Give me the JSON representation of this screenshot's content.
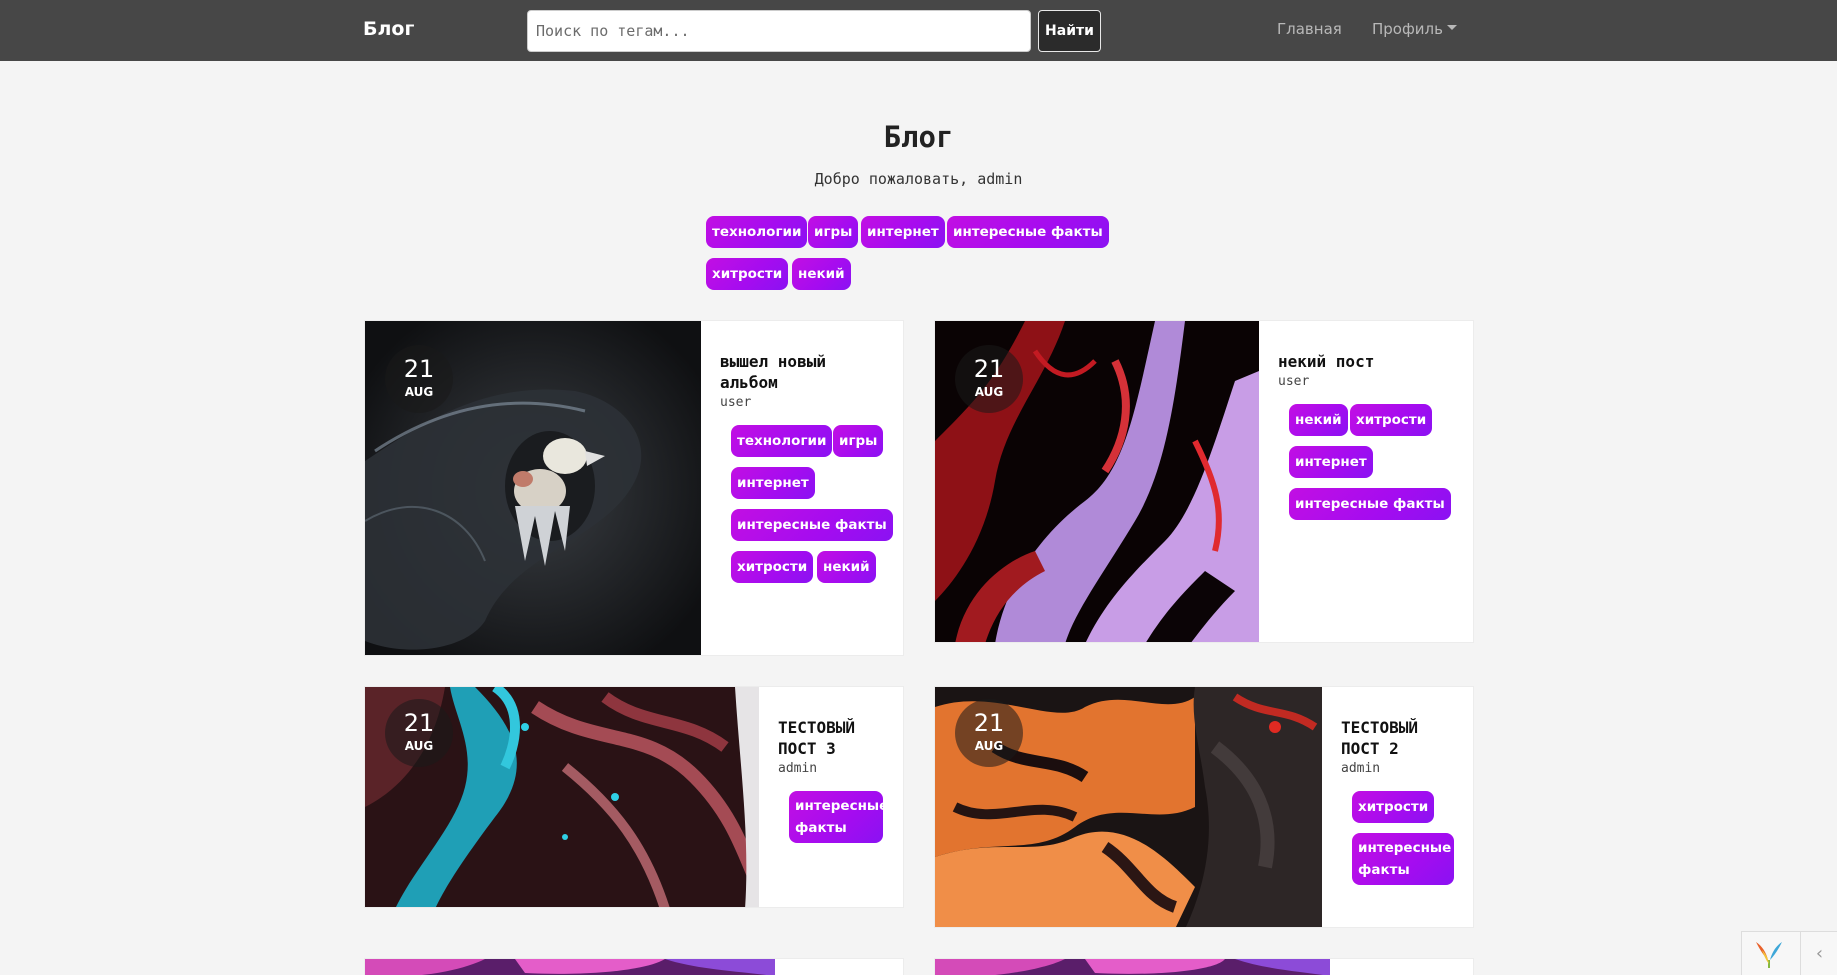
{
  "navbar": {
    "brand": "Блог",
    "search_placeholder": "Поиск по тегам...",
    "search_button": "Найти",
    "home": "Главная",
    "profile": "Профиль"
  },
  "hero": {
    "title": "Блог",
    "subtitle": "Добро пожаловать, admin",
    "tags": [
      "технологии",
      "игры",
      "интернет",
      "интересные факты",
      "хитрости",
      "некий"
    ]
  },
  "posts": [
    {
      "day": "21",
      "month": "AUG",
      "title": "вышел новый альбом",
      "author": "user",
      "tags": [
        "технологии",
        "игры",
        "интернет",
        "интересные факты",
        "хитрости",
        "некий"
      ]
    },
    {
      "day": "21",
      "month": "AUG",
      "title": "некий пост",
      "author": "user",
      "tags": [
        "некий",
        "хитрости",
        "интернет",
        "интересные факты"
      ]
    },
    {
      "day": "21",
      "month": "AUG",
      "title": "ТЕСТОВЫЙ ПОСТ 3",
      "author": "admin",
      "tags": [
        "интересные факты"
      ]
    },
    {
      "day": "21",
      "month": "AUG",
      "title": "ТЕСТОВЫЙ ПОСТ 2",
      "author": "admin",
      "tags": [
        "хитрости",
        "интересные факты"
      ]
    }
  ],
  "colors": {
    "navbar": "#474747",
    "tag_gradient_start": "#c20fe3",
    "tag_gradient_end": "#8a12f2",
    "page_bg": "#f4f4f4"
  },
  "icons": [
    "yii-logo-icon",
    "chevron-left-icon",
    "caret-down-icon"
  ]
}
